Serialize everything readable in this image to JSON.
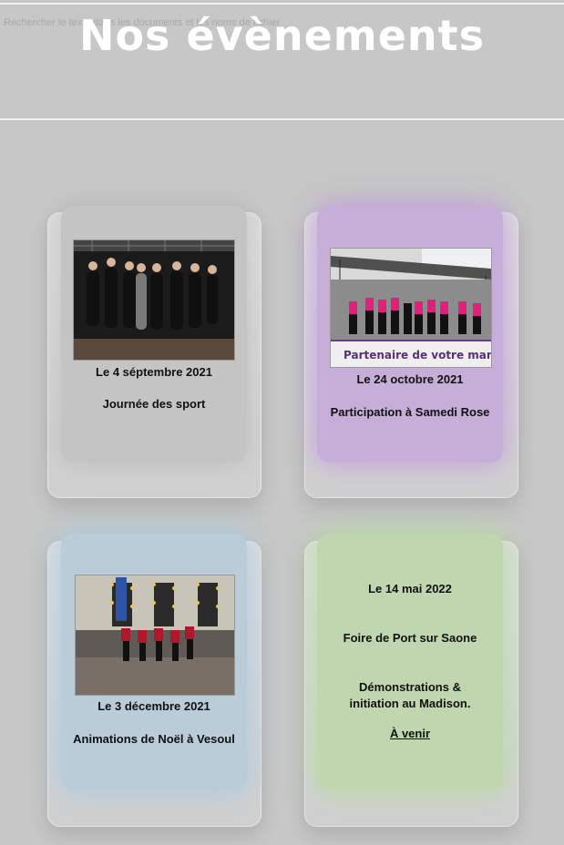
{
  "header": {
    "title": "Nos évènements",
    "search_placeholder": "Rechercher le texte dans les documents et les noms de fichier"
  },
  "events": [
    {
      "date": "Le 4 séptembre 2021",
      "name": "Journée des sport",
      "color": "#c4c4c4"
    },
    {
      "date": "Le 24 octobre 2021",
      "name": "Participation à Samedi Rose",
      "banner_text": "Partenaire de votre manifest",
      "color": "#c7aed8"
    },
    {
      "date": "Le 3 décembre 2021",
      "name": "Animations de Noël à Vesoul",
      "color": "#b9ccd8"
    },
    {
      "date": "Le 14 mai 2022",
      "name": "Foire de Port sur Saone",
      "description_line1": "Démonstrations &",
      "description_line2": "initiation au Madison.",
      "link": "À venir",
      "color": "#c0d6ae"
    }
  ]
}
